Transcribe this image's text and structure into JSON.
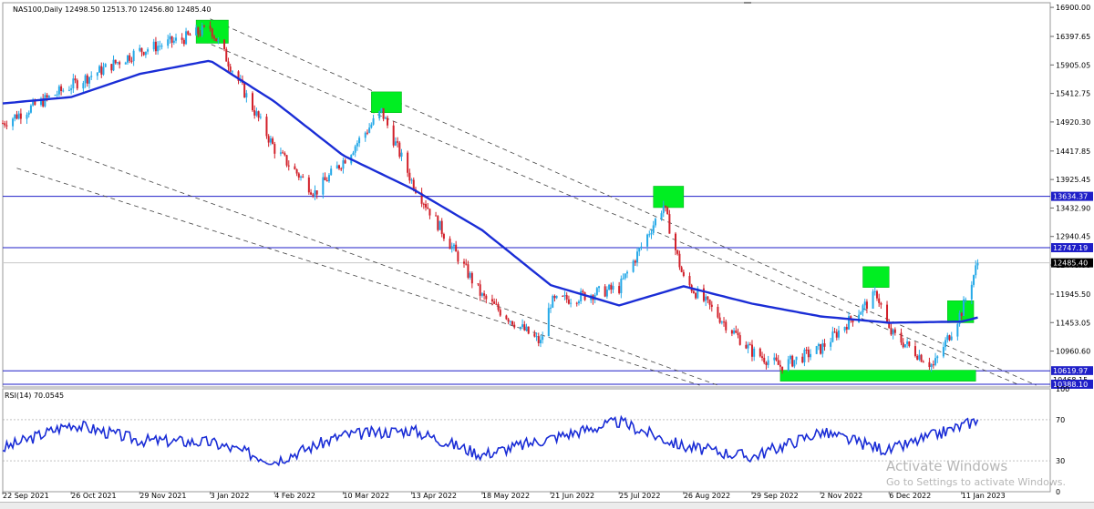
{
  "header": {
    "symbol": "NAS100,Daily",
    "ohlc": "12498.50 12513.70 12456.80 12485.40"
  },
  "rsi_label": "RSI(14) 70.0545",
  "watermark": {
    "title": "Activate Windows",
    "subtitle": "Go to Settings to activate Windows."
  },
  "colors": {
    "bull_candle": "#25a9e8",
    "bear_candle": "#d2202a",
    "moving_average": "#1a2dd6",
    "horizontal_level": "#1f1fc8",
    "highlight_box": "#00ee22",
    "channel_line": "#444444",
    "rsi_line": "#1a2dd6"
  },
  "chart_data": [
    {
      "type": "candlestick",
      "symbol": "NAS100",
      "timeframe": "Daily",
      "x_ticks": [
        "22 Sep 2021",
        "26 Oct 2021",
        "29 Nov 2021",
        "3 Jan 2022",
        "4 Feb 2022",
        "10 Mar 2022",
        "13 Apr 2022",
        "18 May 2022",
        "21 Jun 2022",
        "25 Jul 2022",
        "26 Aug 2022",
        "29 Sep 2022",
        "2 Nov 2022",
        "6 Dec 2022",
        "11 Jan 2023"
      ],
      "y_ticks": [
        16900.0,
        16397.65,
        15905.05,
        15412.75,
        14920.3,
        14417.85,
        13925.45,
        13432.9,
        12940.45,
        12448.0,
        11945.5,
        11453.05,
        10960.6
      ],
      "ylim": [
        10340,
        16980
      ],
      "last_price": 12485.4,
      "horizontal_levels": [
        13634.37,
        12747.19,
        10619.97,
        10388.1
      ],
      "axis_labels": [
        "13634.37",
        "12747.19",
        "12485.40",
        "10619.97",
        "10468.15",
        "10388.10"
      ],
      "moving_average": {
        "x": [
          "22 Sep 2021",
          "26 Oct 2021",
          "29 Nov 2021",
          "3 Jan 2022",
          "4 Feb 2022",
          "10 Mar 2022",
          "13 Apr 2022",
          "18 May 2022",
          "21 Jun 2022",
          "25 Jul 2022",
          "26 Aug 2022",
          "29 Sep 2022",
          "2 Nov 2022",
          "6 Dec 2022",
          "11 Jan 2023",
          "19 Jan 2023"
        ],
        "values": [
          15240,
          15350,
          15750,
          15980,
          15270,
          14340,
          13770,
          13050,
          12100,
          11750,
          12080,
          11780,
          11560,
          11450,
          11470,
          11540
        ]
      },
      "candles_close": {
        "x": [
          "22 Sep 2021",
          "26 Oct 2021",
          "29 Nov 2021",
          "20 Dec 2021",
          "3 Jan 2022",
          "4 Feb 2022",
          "24 Feb 2022",
          "10 Mar 2022",
          "29 Mar 2022",
          "13 Apr 2022",
          "18 May 2022",
          "16 Jun 2022",
          "21 Jun 2022",
          "25 Jul 2022",
          "16 Aug 2022",
          "26 Aug 2022",
          "29 Sep 2022",
          "13 Oct 2022",
          "2 Nov 2022",
          "30 Nov 2022",
          "6 Dec 2022",
          "28 Dec 2022",
          "11 Jan 2023",
          "19 Jan 2023"
        ],
        "values": [
          14900,
          15550,
          16150,
          16350,
          16550,
          14450,
          13700,
          14250,
          15100,
          13900,
          11900,
          11100,
          11800,
          12050,
          13480,
          12200,
          10950,
          10700,
          11000,
          11950,
          11300,
          10700,
          11650,
          12485.4
        ]
      },
      "highlight_boxes": [
        {
          "start": "27 Dec 2021",
          "end": "12 Jan 2022",
          "low": 16280,
          "high": 16680
        },
        {
          "start": "24 Mar 2022",
          "end": "8 Apr 2022",
          "low": 15080,
          "high": 15440
        },
        {
          "start": "11 Aug 2022",
          "end": "26 Aug 2022",
          "low": 13440,
          "high": 13810
        },
        {
          "start": "23 Nov 2022",
          "end": "6 Dec 2022",
          "low": 12060,
          "high": 12420
        },
        {
          "start": "4 Jan 2023",
          "end": "17 Jan 2023",
          "low": 11450,
          "high": 11830
        },
        {
          "start": "13 Oct 2022",
          "end": "18 Jan 2023",
          "low": 10440,
          "high": 10630
        }
      ],
      "channel_lines": [
        {
          "start": [
            "3 Jan 2022",
            16700
          ],
          "end": [
            "17 Feb 2023",
            10370
          ]
        },
        {
          "start": [
            "27 Dec 2021",
            16370
          ],
          "end": [
            "9 Feb 2023",
            10370
          ]
        },
        {
          "start": [
            "11 Oct 2021",
            14570
          ],
          "end": [
            "12 Sep 2022",
            10370
          ]
        },
        {
          "start": [
            "29 Sep 2021",
            14120
          ],
          "end": [
            "3 Sep 2022",
            10370
          ]
        }
      ]
    },
    {
      "type": "line",
      "name": "RSI(14)",
      "ylim": [
        0,
        100
      ],
      "y_ticks": [
        100,
        70,
        30,
        0
      ],
      "levels": [
        70,
        30
      ],
      "x": [
        "22 Sep 2021",
        "26 Oct 2021",
        "29 Nov 2021",
        "3 Jan 2022",
        "4 Feb 2022",
        "10 Mar 2022",
        "13 Apr 2022",
        "18 May 2022",
        "21 Jun 2022",
        "25 Jul 2022",
        "26 Aug 2022",
        "29 Sep 2022",
        "2 Nov 2022",
        "6 Dec 2022",
        "11 Jan 2023",
        "19 Jan 2023"
      ],
      "values": [
        42,
        66,
        50,
        48,
        30,
        55,
        60,
        36,
        52,
        68,
        44,
        34,
        58,
        40,
        64,
        70.05
      ]
    }
  ]
}
